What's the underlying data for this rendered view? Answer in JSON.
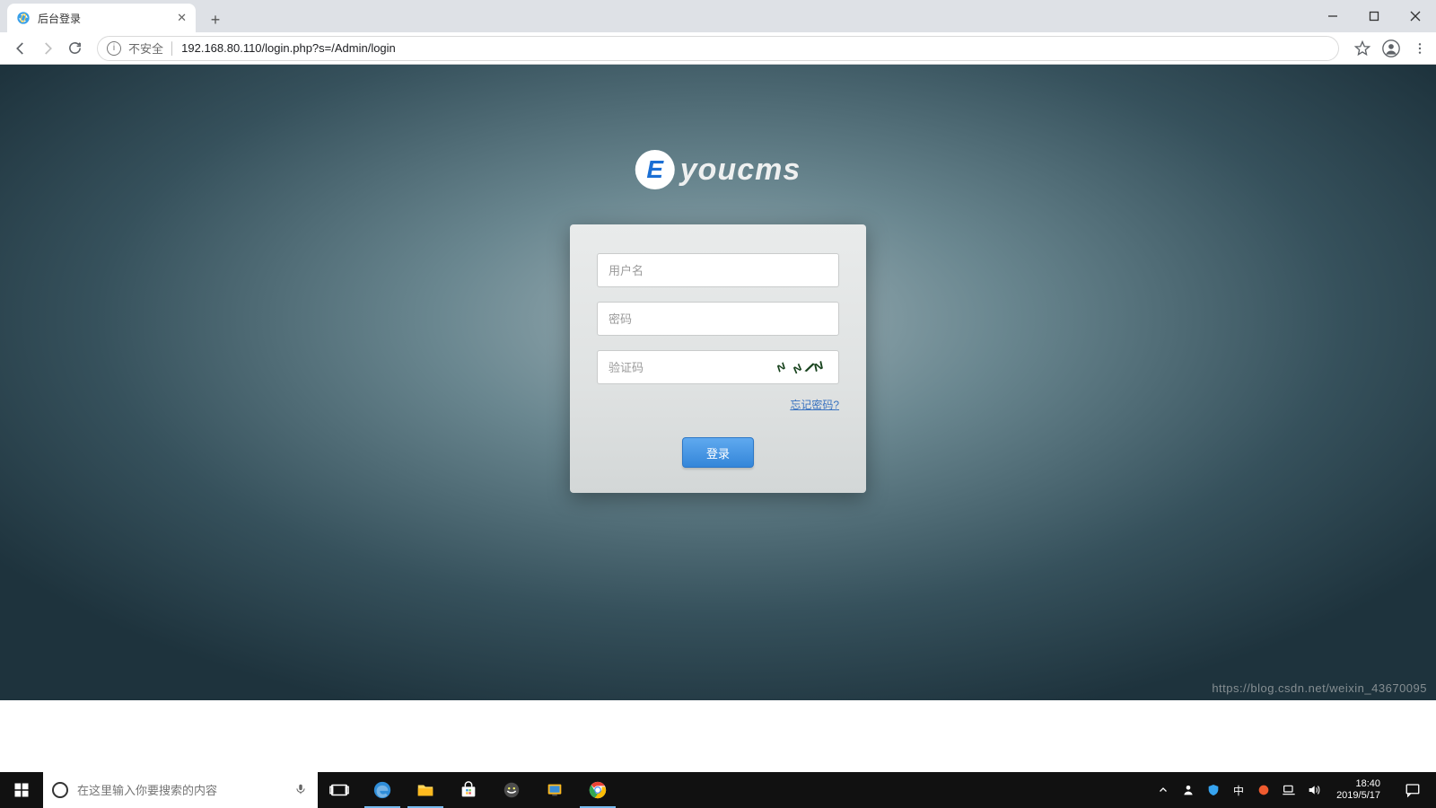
{
  "browser": {
    "tab_title": "后台登录",
    "security_label": "不安全",
    "url": "192.168.80.110/login.php?s=/Admin/login"
  },
  "logo": {
    "badge": "E",
    "text": "youcms"
  },
  "login": {
    "username_placeholder": "用户名",
    "password_placeholder": "密码",
    "captcha_placeholder": "验证码",
    "forgot_label": "忘记密码?",
    "submit_label": "登录"
  },
  "taskbar": {
    "search_placeholder": "在这里输入你要搜索的内容",
    "ime": "中",
    "time": "18:40",
    "date": "2019/5/17"
  },
  "watermark": "https://blog.csdn.net/weixin_43670095"
}
